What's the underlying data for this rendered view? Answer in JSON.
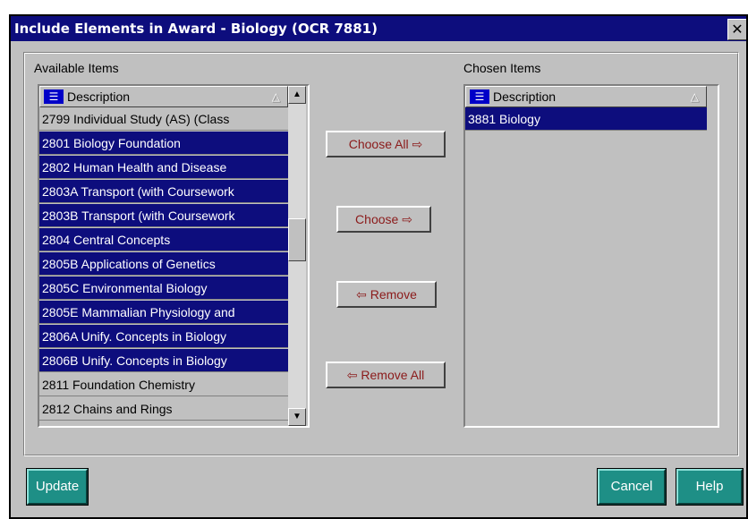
{
  "window": {
    "title": "Include Elements in Award - Biology (OCR 7881)",
    "close_glyph": "✕"
  },
  "available": {
    "label": "Available Items",
    "header": "Description",
    "header_icon": "list-icon",
    "sort_glyph": "△",
    "items": [
      {
        "text": "2799 Individual Study (AS)  (Class",
        "selected": false
      },
      {
        "text": "2801 Biology Foundation",
        "selected": true
      },
      {
        "text": "2802 Human Health and Disease",
        "selected": true
      },
      {
        "text": "2803A Transport  (with Coursework",
        "selected": true
      },
      {
        "text": "2803B Transport  (with Coursework",
        "selected": true
      },
      {
        "text": "2804 Central Concepts",
        "selected": true
      },
      {
        "text": "2805B Applications of Genetics",
        "selected": true
      },
      {
        "text": "2805C Environmental Biology",
        "selected": true
      },
      {
        "text": "2805E Mammalian Physiology and",
        "selected": true
      },
      {
        "text": "2806A Unify.  Concepts in Biology",
        "selected": true
      },
      {
        "text": "2806B Unify.  Concepts in Biology",
        "selected": true
      },
      {
        "text": "2811 Foundation Chemistry",
        "selected": false
      },
      {
        "text": "2812 Chains and Rings",
        "selected": false
      }
    ]
  },
  "chosen": {
    "label": "Chosen Items",
    "header": "Description",
    "sort_glyph": "△",
    "items": [
      {
        "text": "3881 Biology",
        "selected": true
      }
    ]
  },
  "buttons": {
    "choose_all": "Choose All",
    "choose_all_arrow": "⇨",
    "choose": "Choose",
    "choose_arrow": "⇨",
    "remove": "Remove",
    "remove_arrow": "⇦",
    "remove_all": "Remove All",
    "remove_all_arrow": "⇦",
    "update": "Update",
    "cancel": "Cancel",
    "help": "Help"
  },
  "scrollbar": {
    "up_glyph": "▲",
    "down_glyph": "▼"
  },
  "colors": {
    "selection": "#0d0d7d",
    "button_text": "#8b1a1a",
    "teal": "#1e8f86"
  }
}
